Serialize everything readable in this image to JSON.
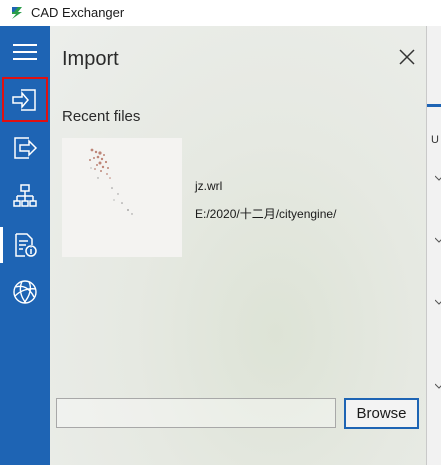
{
  "window": {
    "title": "CAD Exchanger"
  },
  "sidebar": {
    "items": [
      {
        "name": "menu",
        "icon": "hamburger-menu-icon"
      },
      {
        "name": "import",
        "icon": "import-icon"
      },
      {
        "name": "export",
        "icon": "export-icon"
      },
      {
        "name": "structure",
        "icon": "structure-tree-icon"
      },
      {
        "name": "properties",
        "icon": "document-info-icon"
      },
      {
        "name": "web",
        "icon": "globe-icon"
      }
    ]
  },
  "panel": {
    "title": "Import",
    "recent_label": "Recent files",
    "recent_files": [
      {
        "name": "jz.wrl",
        "path": "E:/2020/十二月/cityengine/"
      }
    ],
    "path_input": {
      "value": "",
      "placeholder": ""
    },
    "browse_label": "Browse"
  },
  "right_panel": {
    "partial_label": "U"
  },
  "colors": {
    "sidebar": "#1e64b4",
    "highlight": "#e01010",
    "accent": "#1e64b4"
  }
}
